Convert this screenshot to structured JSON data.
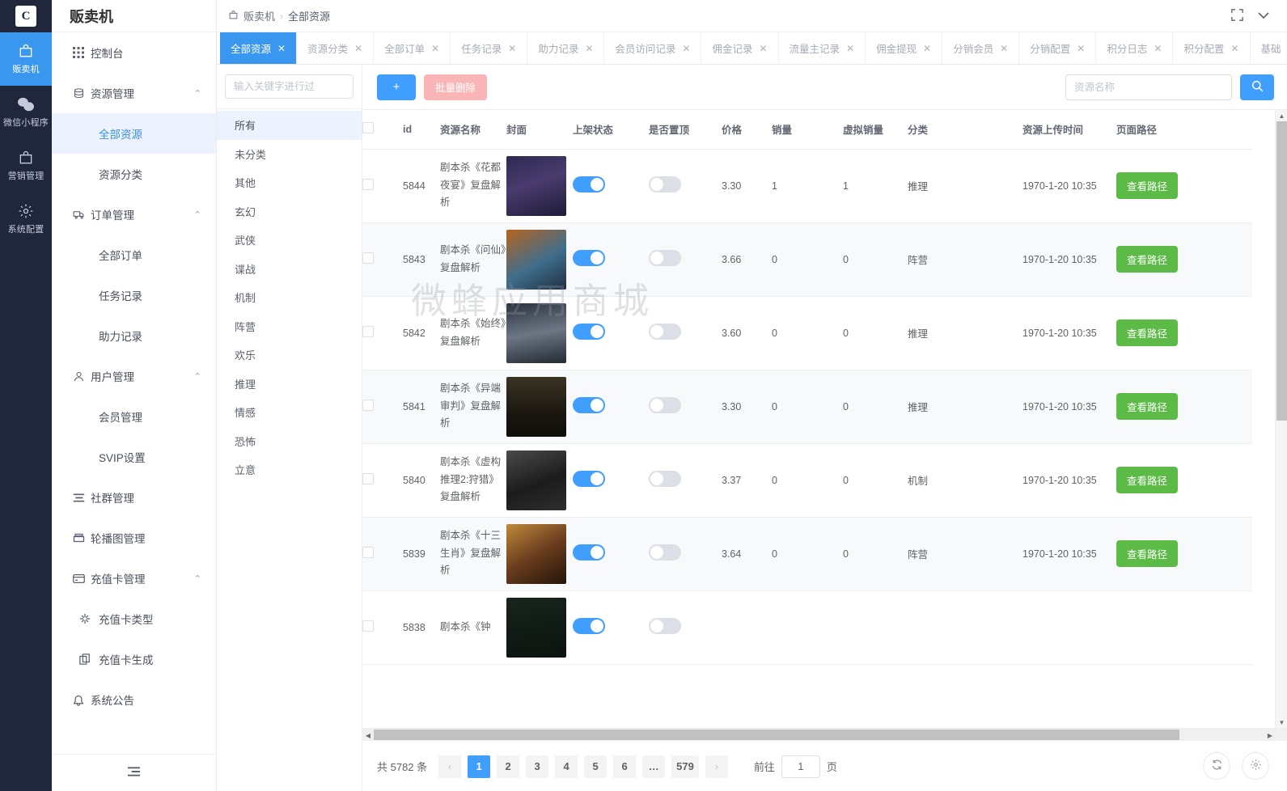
{
  "rail": {
    "logo_text": "C",
    "items": [
      {
        "label": "贩卖机",
        "icon": "shop-bag-icon",
        "active": true
      },
      {
        "label": "微信小程序",
        "icon": "wechat-icon",
        "active": false
      },
      {
        "label": "营销管理",
        "icon": "shop-bag-icon",
        "active": false
      },
      {
        "label": "系统配置",
        "icon": "gear-icon",
        "active": false
      }
    ]
  },
  "sidebar": {
    "title": "贩卖机",
    "collapse_icon": "collapse-menu-icon",
    "items": [
      {
        "label": "控制台",
        "icon": "grid-icon",
        "type": "row",
        "arrow": ""
      },
      {
        "label": "资源管理",
        "icon": "database-icon",
        "type": "row",
        "arrow": "⌃"
      },
      {
        "label": "全部资源",
        "icon": "",
        "type": "sub",
        "active": true
      },
      {
        "label": "资源分类",
        "icon": "",
        "type": "sub",
        "active": false
      },
      {
        "label": "订单管理",
        "icon": "truck-icon",
        "type": "row",
        "arrow": "⌃"
      },
      {
        "label": "全部订单",
        "icon": "",
        "type": "sub",
        "active": false
      },
      {
        "label": "任务记录",
        "icon": "",
        "type": "sub",
        "active": false
      },
      {
        "label": "助力记录",
        "icon": "",
        "type": "sub",
        "active": false
      },
      {
        "label": "用户管理",
        "icon": "user-icon",
        "type": "row",
        "arrow": "⌃"
      },
      {
        "label": "会员管理",
        "icon": "",
        "type": "sub",
        "active": false
      },
      {
        "label": "SVIP设置",
        "icon": "",
        "type": "sub",
        "active": false
      },
      {
        "label": "社群管理",
        "icon": "list-icon",
        "type": "row",
        "arrow": ""
      },
      {
        "label": "轮播图管理",
        "icon": "carousel-icon",
        "type": "row",
        "arrow": ""
      },
      {
        "label": "充值卡管理",
        "icon": "card-icon",
        "type": "row",
        "arrow": "⌃"
      },
      {
        "label": "充值卡类型",
        "icon": "sparkle-icon",
        "type": "sub",
        "active": false
      },
      {
        "label": "充值卡生成",
        "icon": "copy-icon",
        "type": "sub",
        "active": false
      },
      {
        "label": "系统公告",
        "icon": "bell-icon",
        "type": "row",
        "arrow": ""
      }
    ]
  },
  "breadcrumb": {
    "home_icon": "shop-bag-icon",
    "home": "贩卖机",
    "separator": "›",
    "current": "全部资源",
    "fullscreen_icon": "fullscreen-icon",
    "chevron_icon": "chevron-down-icon"
  },
  "tabs": [
    {
      "label": "全部资源",
      "active": true
    },
    {
      "label": "资源分类",
      "active": false
    },
    {
      "label": "全部订单",
      "active": false
    },
    {
      "label": "任务记录",
      "active": false
    },
    {
      "label": "助力记录",
      "active": false
    },
    {
      "label": "会员访问记录",
      "active": false
    },
    {
      "label": "佣金记录",
      "active": false
    },
    {
      "label": "流量主记录",
      "active": false
    },
    {
      "label": "佣金提现",
      "active": false
    },
    {
      "label": "分销会员",
      "active": false
    },
    {
      "label": "分销配置",
      "active": false
    },
    {
      "label": "积分日志",
      "active": false
    },
    {
      "label": "积分配置",
      "active": false
    },
    {
      "label": "基础",
      "active": false
    }
  ],
  "categories": {
    "search_placeholder": "输入关键字进行过",
    "search_value": "",
    "items": [
      {
        "label": "所有",
        "active": true
      },
      {
        "label": "未分类",
        "active": false
      },
      {
        "label": "其他",
        "active": false
      },
      {
        "label": "玄幻",
        "active": false
      },
      {
        "label": "武侠",
        "active": false
      },
      {
        "label": "谍战",
        "active": false
      },
      {
        "label": "机制",
        "active": false
      },
      {
        "label": "阵营",
        "active": false
      },
      {
        "label": "欢乐",
        "active": false
      },
      {
        "label": "推理",
        "active": false
      },
      {
        "label": "情感",
        "active": false
      },
      {
        "label": "恐怖",
        "active": false
      },
      {
        "label": "立意",
        "active": false
      }
    ]
  },
  "toolbar": {
    "add_label": "+",
    "bulk_delete_label": "批量删除",
    "search_placeholder": "资源名称",
    "search_value": "",
    "search_icon": "search-icon"
  },
  "table": {
    "columns": [
      "",
      "id",
      "资源名称",
      "封面",
      "上架状态",
      "是否置顶",
      "价格",
      "销量",
      "虚拟销量",
      "分类",
      "资源上传时间",
      "页面路径"
    ],
    "action_label": "查看路径",
    "rows": [
      {
        "id": "5844",
        "name": "剧本杀《花都夜宴》复盘解析",
        "cover": "#3b3a63",
        "on_shelf": true,
        "pinned": false,
        "price": "3.30",
        "sales": "1",
        "virtual_sales": "1",
        "category": "推理",
        "upload_time": "1970-1-20 10:35"
      },
      {
        "id": "5843",
        "name": "剧本杀《问仙》复盘解析",
        "cover": "#9a5b33",
        "on_shelf": true,
        "pinned": false,
        "price": "3.66",
        "sales": "0",
        "virtual_sales": "0",
        "category": "阵营",
        "upload_time": "1970-1-20 10:35"
      },
      {
        "id": "5842",
        "name": "剧本杀《始终》复盘解析",
        "cover": "#3d4550",
        "on_shelf": true,
        "pinned": false,
        "price": "3.60",
        "sales": "0",
        "virtual_sales": "0",
        "category": "推理",
        "upload_time": "1970-1-20 10:35"
      },
      {
        "id": "5841",
        "name": "剧本杀《异端审判》复盘解析",
        "cover": "#272218",
        "on_shelf": true,
        "pinned": false,
        "price": "3.30",
        "sales": "0",
        "virtual_sales": "0",
        "category": "推理",
        "upload_time": "1970-1-20 10:35"
      },
      {
        "id": "5840",
        "name": "剧本杀《虚构推理2:狩猎》复盘解析",
        "cover": "#2b2b2b",
        "on_shelf": true,
        "pinned": false,
        "price": "3.37",
        "sales": "0",
        "virtual_sales": "0",
        "category": "机制",
        "upload_time": "1970-1-20 10:35"
      },
      {
        "id": "5839",
        "name": "剧本杀《十三生肖》复盘解析",
        "cover": "#6b4a26",
        "on_shelf": true,
        "pinned": false,
        "price": "3.64",
        "sales": "0",
        "virtual_sales": "0",
        "category": "阵营",
        "upload_time": "1970-1-20 10:35"
      },
      {
        "id": "5838",
        "name": "剧本杀《钟",
        "cover": "#1e2a22",
        "on_shelf": true,
        "pinned": false,
        "price": "",
        "sales": "",
        "virtual_sales": "",
        "category": "",
        "upload_time": ""
      }
    ]
  },
  "watermark": "微蜂应用商城",
  "pagination": {
    "total_text": "共 5782 条",
    "prev_icon": "‹",
    "next_icon": "›",
    "pages": [
      "1",
      "2",
      "3",
      "4",
      "5",
      "6",
      "…",
      "579"
    ],
    "current_page": "1",
    "jump_prefix": "前往",
    "jump_value": "1",
    "jump_suffix": "页"
  },
  "fabs": [
    {
      "icon": "refresh-icon",
      "name": "refresh-button"
    },
    {
      "icon": "gear-icon",
      "name": "settings-button"
    }
  ],
  "colors": {
    "accent": "#409eff",
    "rail_bg": "#20263b",
    "tab_active": "#3a97ef",
    "action_green": "#5cbb46",
    "danger_soft": "#fab6b6"
  }
}
